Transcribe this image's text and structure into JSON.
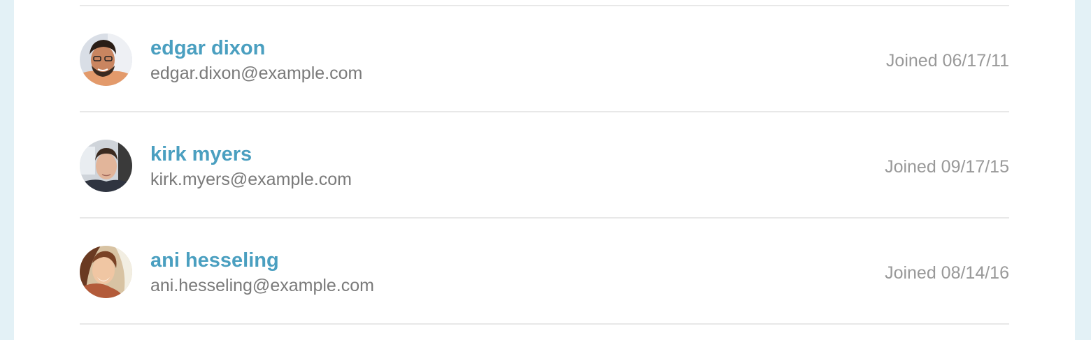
{
  "users": [
    {
      "name": "edgar dixon",
      "email": "edgar.dixon@example.com",
      "joined": "Joined 06/17/11",
      "avatar": "avatar-photo-man-dark-hair-glasses"
    },
    {
      "name": "kirk myers",
      "email": "kirk.myers@example.com",
      "joined": "Joined 09/17/15",
      "avatar": "avatar-photo-man-short-hair"
    },
    {
      "name": "ani hesseling",
      "email": "ani.hesseling@example.com",
      "joined": "Joined 08/14/16",
      "avatar": "avatar-photo-woman-smiling"
    }
  ],
  "colors": {
    "page_background": "#e3f1f6",
    "panel_background": "#ffffff",
    "name_link": "#4a9fc0",
    "email_text": "#7a7a7a",
    "joined_text": "#999999",
    "divider": "#e8e8e8"
  }
}
